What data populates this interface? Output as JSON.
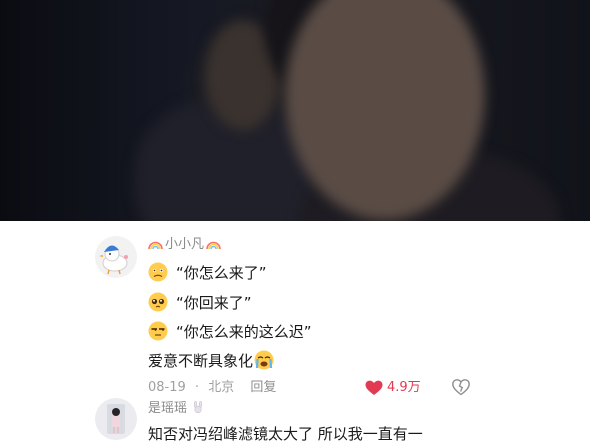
{
  "comment1": {
    "username": "小小凡",
    "lines": [
      {
        "emoji": "worried-face-icon",
        "text": "“你怎么来了”"
      },
      {
        "emoji": "pleading-face-icon",
        "text": "“你回来了”"
      },
      {
        "emoji": "unamused-face-icon",
        "text": "“你怎么来的这么迟”"
      },
      {
        "emoji": "",
        "text": "爱意不断具象化"
      }
    ],
    "end_emoji": "loudly-crying-face-icon",
    "date": "08-19",
    "location": "北京",
    "reply_label": "回复",
    "likes": "4.9万"
  },
  "comment2": {
    "username": "是瑶瑶",
    "text": "知否对冯绍峰滤镜太大了 所以我一直有一"
  },
  "colors": {
    "like": "#e23a52",
    "muted": "#a0a0a0",
    "text": "#1a1a1a"
  }
}
